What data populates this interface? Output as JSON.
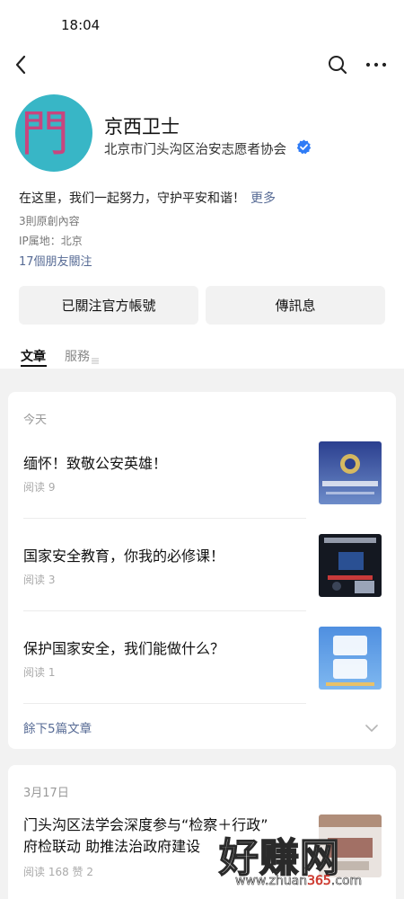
{
  "status_bar": {
    "time": "18:04"
  },
  "profile": {
    "avatar_text": "門",
    "avatar_side_text": "京西衛士",
    "name": "京西卫士",
    "org": "北京市门头沟区治安志愿者协会",
    "bio": "在这里，我们一起努力，守护平安和谐！",
    "bio_more": "更多",
    "original_count": "3則原創內容",
    "ip_location": "IP属地：北京",
    "friends_following": "17個朋友關注"
  },
  "actions": {
    "follow_label": "已關注官方帳號",
    "message_label": "傳訊息"
  },
  "tabs": [
    {
      "label": "文章",
      "active": true
    },
    {
      "label": "服務",
      "active": false
    }
  ],
  "feed": {
    "groups": [
      {
        "date": "今天",
        "articles": [
          {
            "title": "缅怀！致敬公安英雄！",
            "meta": "阅读 9",
            "thumb": "police-hero-thumbnail"
          },
          {
            "title": "国家安全教育，你我的必修课！",
            "meta": "阅读 3",
            "thumb": "security-education-thumbnail"
          },
          {
            "title": "保护国家安全，我们能做什么？",
            "meta": "阅读 1",
            "thumb": "anquan-thumbnail"
          }
        ],
        "remaining_label": "餘下5篇文章"
      },
      {
        "date": "3月17日",
        "articles": [
          {
            "title_line1": "门头沟区法学会深度参与“检察＋行政”",
            "title_line2": "府检联动 助推法治政府建设",
            "meta": "阅读 168   赞 2",
            "thumb": "legal-meeting-thumbnail"
          }
        ]
      }
    ]
  },
  "watermark": {
    "big": "好赚网",
    "url_part1": "www.zhuan",
    "url_accent": "365",
    "url_part2": ".com"
  },
  "colors": {
    "link": "#576b95",
    "avatar_bg": "#38b6c6",
    "verified": "#2f7cf6",
    "feed_bg": "#f2f2f2"
  }
}
